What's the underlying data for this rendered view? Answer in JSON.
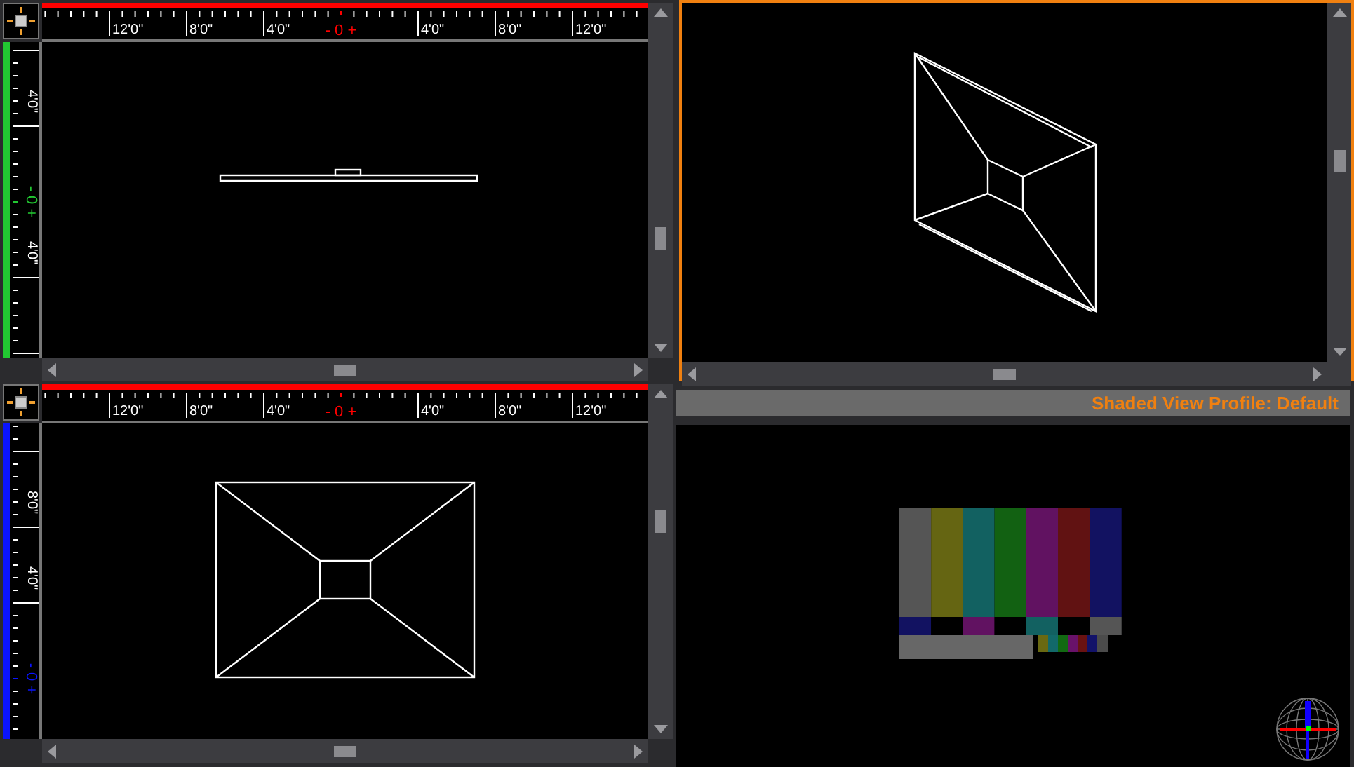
{
  "ortho_views": [
    {
      "kind": "front",
      "horizontal_labels": [
        "12'0\"",
        "8'0\"",
        "4'0\"",
        "- 0 +",
        "4'0\"",
        "8'0\"",
        "12'0\""
      ],
      "vertical_labels": [
        "4'0\"",
        "- 0 +",
        "4'0\""
      ],
      "color": "#22c832"
    },
    {
      "kind": "top",
      "horizontal_labels": [
        "12'0\"",
        "8'0\"",
        "4'0\"",
        "- 0 +",
        "4'0\"",
        "8'0\"",
        "12'0\""
      ],
      "vertical_labels": [
        "8'0\"",
        "4'0\"",
        "- 0 +"
      ],
      "color": "#0a14ff"
    }
  ],
  "perspective_view": {
    "selected": true
  },
  "shaded_view": {
    "title": "Shaded View Profile: Default"
  }
}
